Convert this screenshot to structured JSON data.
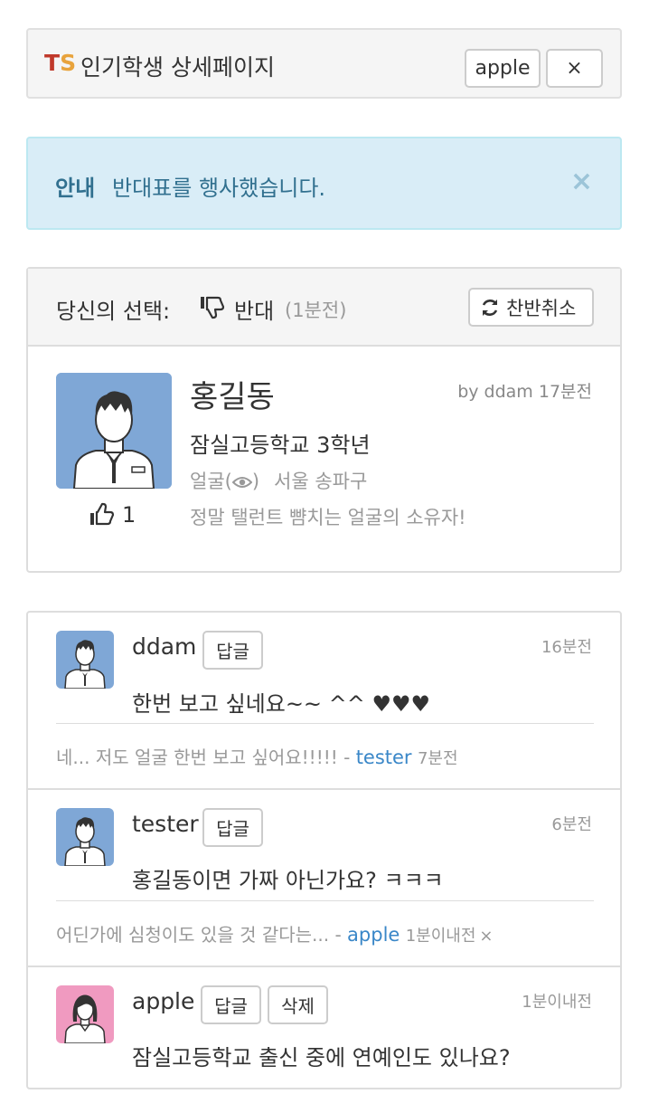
{
  "header": {
    "logo_t": "T",
    "logo_s": "S",
    "title": "인기학생 상세페이지",
    "user_label": "apple",
    "close_label": "×"
  },
  "alert": {
    "label": "안내",
    "message": "반대표를 행사했습니다.",
    "close": "×"
  },
  "choice": {
    "label": "당신의 선택:",
    "value": "반대",
    "time": "(1분전)",
    "cancel_label": "찬반취소"
  },
  "student": {
    "name": "홍길동",
    "by": "by ddam 17분전",
    "school": "잠실고등학교 3학년",
    "tag_prefix": "얼굴(",
    "tag_suffix": ")",
    "location": "서울 송파구",
    "description": "정말 탤런트 뺨치는 얼굴의 소유자!",
    "likes": "1"
  },
  "comments": [
    {
      "author": "ddam",
      "reply_label": "답글",
      "time": "16분전",
      "text": "한번 보고 싶네요~~ ^^ ♥♥♥",
      "reply": {
        "text": "네... 저도 얼굴 한번 보고 싶어요!!!!! - ",
        "author": "tester",
        "time": "7분전"
      }
    },
    {
      "author": "tester",
      "reply_label": "답글",
      "time": "6분전",
      "text": "홍길동이면 가짜 아닌가요? ㅋㅋㅋ",
      "reply": {
        "text": "어딘가에 심청이도 있을 것 같다는... - ",
        "author": "apple",
        "time": "1분이내전",
        "delete": "×"
      }
    },
    {
      "author": "apple",
      "reply_label": "답글",
      "delete_label": "삭제",
      "time": "1분이내전",
      "text": "잠실고등학교 출신 중에 연예인도 있나요?"
    }
  ],
  "colors": {
    "logo_t": "#c0392b",
    "logo_s": "#e8a33c",
    "alert_bg": "#d9edf7",
    "alert_text": "#31708f",
    "link": "#3a87c8",
    "avatar_male": "#7fa7d6",
    "avatar_female": "#f09ac0"
  }
}
